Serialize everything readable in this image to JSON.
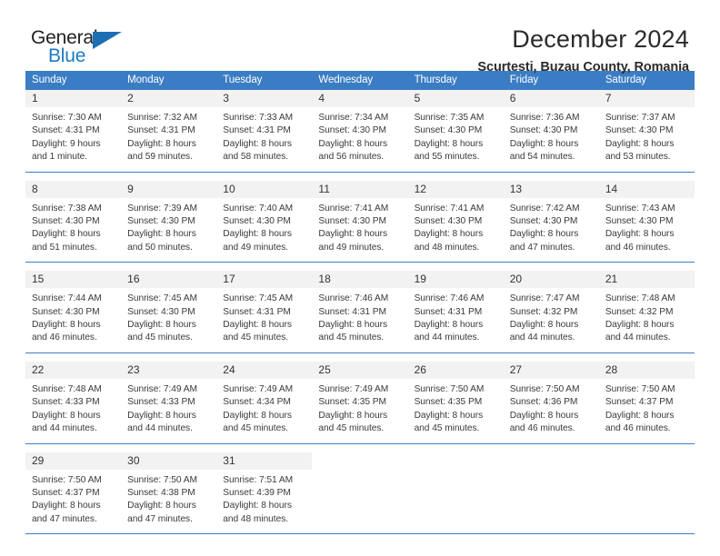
{
  "logo": {
    "word_one": "General",
    "word_two": "Blue",
    "triangle_color": "#1c6fb5",
    "blue_color": "#1c7cc0"
  },
  "header": {
    "title": "December 2024",
    "location": "Scurtesti, Buzau County, Romania"
  },
  "theme": {
    "header_bg": "#3b7dc4",
    "day_band_bg": "#f2f2f2",
    "text": "#3a3a3a"
  },
  "weekdays": [
    "Sunday",
    "Monday",
    "Tuesday",
    "Wednesday",
    "Thursday",
    "Friday",
    "Saturday"
  ],
  "weeks": [
    [
      {
        "day": "1",
        "sunrise": "Sunrise: 7:30 AM",
        "sunset": "Sunset: 4:31 PM",
        "daylight1": "Daylight: 9 hours",
        "daylight2": "and 1 minute."
      },
      {
        "day": "2",
        "sunrise": "Sunrise: 7:32 AM",
        "sunset": "Sunset: 4:31 PM",
        "daylight1": "Daylight: 8 hours",
        "daylight2": "and 59 minutes."
      },
      {
        "day": "3",
        "sunrise": "Sunrise: 7:33 AM",
        "sunset": "Sunset: 4:31 PM",
        "daylight1": "Daylight: 8 hours",
        "daylight2": "and 58 minutes."
      },
      {
        "day": "4",
        "sunrise": "Sunrise: 7:34 AM",
        "sunset": "Sunset: 4:30 PM",
        "daylight1": "Daylight: 8 hours",
        "daylight2": "and 56 minutes."
      },
      {
        "day": "5",
        "sunrise": "Sunrise: 7:35 AM",
        "sunset": "Sunset: 4:30 PM",
        "daylight1": "Daylight: 8 hours",
        "daylight2": "and 55 minutes."
      },
      {
        "day": "6",
        "sunrise": "Sunrise: 7:36 AM",
        "sunset": "Sunset: 4:30 PM",
        "daylight1": "Daylight: 8 hours",
        "daylight2": "and 54 minutes."
      },
      {
        "day": "7",
        "sunrise": "Sunrise: 7:37 AM",
        "sunset": "Sunset: 4:30 PM",
        "daylight1": "Daylight: 8 hours",
        "daylight2": "and 53 minutes."
      }
    ],
    [
      {
        "day": "8",
        "sunrise": "Sunrise: 7:38 AM",
        "sunset": "Sunset: 4:30 PM",
        "daylight1": "Daylight: 8 hours",
        "daylight2": "and 51 minutes."
      },
      {
        "day": "9",
        "sunrise": "Sunrise: 7:39 AM",
        "sunset": "Sunset: 4:30 PM",
        "daylight1": "Daylight: 8 hours",
        "daylight2": "and 50 minutes."
      },
      {
        "day": "10",
        "sunrise": "Sunrise: 7:40 AM",
        "sunset": "Sunset: 4:30 PM",
        "daylight1": "Daylight: 8 hours",
        "daylight2": "and 49 minutes."
      },
      {
        "day": "11",
        "sunrise": "Sunrise: 7:41 AM",
        "sunset": "Sunset: 4:30 PM",
        "daylight1": "Daylight: 8 hours",
        "daylight2": "and 49 minutes."
      },
      {
        "day": "12",
        "sunrise": "Sunrise: 7:41 AM",
        "sunset": "Sunset: 4:30 PM",
        "daylight1": "Daylight: 8 hours",
        "daylight2": "and 48 minutes."
      },
      {
        "day": "13",
        "sunrise": "Sunrise: 7:42 AM",
        "sunset": "Sunset: 4:30 PM",
        "daylight1": "Daylight: 8 hours",
        "daylight2": "and 47 minutes."
      },
      {
        "day": "14",
        "sunrise": "Sunrise: 7:43 AM",
        "sunset": "Sunset: 4:30 PM",
        "daylight1": "Daylight: 8 hours",
        "daylight2": "and 46 minutes."
      }
    ],
    [
      {
        "day": "15",
        "sunrise": "Sunrise: 7:44 AM",
        "sunset": "Sunset: 4:30 PM",
        "daylight1": "Daylight: 8 hours",
        "daylight2": "and 46 minutes."
      },
      {
        "day": "16",
        "sunrise": "Sunrise: 7:45 AM",
        "sunset": "Sunset: 4:30 PM",
        "daylight1": "Daylight: 8 hours",
        "daylight2": "and 45 minutes."
      },
      {
        "day": "17",
        "sunrise": "Sunrise: 7:45 AM",
        "sunset": "Sunset: 4:31 PM",
        "daylight1": "Daylight: 8 hours",
        "daylight2": "and 45 minutes."
      },
      {
        "day": "18",
        "sunrise": "Sunrise: 7:46 AM",
        "sunset": "Sunset: 4:31 PM",
        "daylight1": "Daylight: 8 hours",
        "daylight2": "and 45 minutes."
      },
      {
        "day": "19",
        "sunrise": "Sunrise: 7:46 AM",
        "sunset": "Sunset: 4:31 PM",
        "daylight1": "Daylight: 8 hours",
        "daylight2": "and 44 minutes."
      },
      {
        "day": "20",
        "sunrise": "Sunrise: 7:47 AM",
        "sunset": "Sunset: 4:32 PM",
        "daylight1": "Daylight: 8 hours",
        "daylight2": "and 44 minutes."
      },
      {
        "day": "21",
        "sunrise": "Sunrise: 7:48 AM",
        "sunset": "Sunset: 4:32 PM",
        "daylight1": "Daylight: 8 hours",
        "daylight2": "and 44 minutes."
      }
    ],
    [
      {
        "day": "22",
        "sunrise": "Sunrise: 7:48 AM",
        "sunset": "Sunset: 4:33 PM",
        "daylight1": "Daylight: 8 hours",
        "daylight2": "and 44 minutes."
      },
      {
        "day": "23",
        "sunrise": "Sunrise: 7:49 AM",
        "sunset": "Sunset: 4:33 PM",
        "daylight1": "Daylight: 8 hours",
        "daylight2": "and 44 minutes."
      },
      {
        "day": "24",
        "sunrise": "Sunrise: 7:49 AM",
        "sunset": "Sunset: 4:34 PM",
        "daylight1": "Daylight: 8 hours",
        "daylight2": "and 45 minutes."
      },
      {
        "day": "25",
        "sunrise": "Sunrise: 7:49 AM",
        "sunset": "Sunset: 4:35 PM",
        "daylight1": "Daylight: 8 hours",
        "daylight2": "and 45 minutes."
      },
      {
        "day": "26",
        "sunrise": "Sunrise: 7:50 AM",
        "sunset": "Sunset: 4:35 PM",
        "daylight1": "Daylight: 8 hours",
        "daylight2": "and 45 minutes."
      },
      {
        "day": "27",
        "sunrise": "Sunrise: 7:50 AM",
        "sunset": "Sunset: 4:36 PM",
        "daylight1": "Daylight: 8 hours",
        "daylight2": "and 46 minutes."
      },
      {
        "day": "28",
        "sunrise": "Sunrise: 7:50 AM",
        "sunset": "Sunset: 4:37 PM",
        "daylight1": "Daylight: 8 hours",
        "daylight2": "and 46 minutes."
      }
    ],
    [
      {
        "day": "29",
        "sunrise": "Sunrise: 7:50 AM",
        "sunset": "Sunset: 4:37 PM",
        "daylight1": "Daylight: 8 hours",
        "daylight2": "and 47 minutes."
      },
      {
        "day": "30",
        "sunrise": "Sunrise: 7:50 AM",
        "sunset": "Sunset: 4:38 PM",
        "daylight1": "Daylight: 8 hours",
        "daylight2": "and 47 minutes."
      },
      {
        "day": "31",
        "sunrise": "Sunrise: 7:51 AM",
        "sunset": "Sunset: 4:39 PM",
        "daylight1": "Daylight: 8 hours",
        "daylight2": "and 48 minutes."
      },
      {
        "day": "",
        "sunrise": "",
        "sunset": "",
        "daylight1": "",
        "daylight2": ""
      },
      {
        "day": "",
        "sunrise": "",
        "sunset": "",
        "daylight1": "",
        "daylight2": ""
      },
      {
        "day": "",
        "sunrise": "",
        "sunset": "",
        "daylight1": "",
        "daylight2": ""
      },
      {
        "day": "",
        "sunrise": "",
        "sunset": "",
        "daylight1": "",
        "daylight2": ""
      }
    ]
  ]
}
